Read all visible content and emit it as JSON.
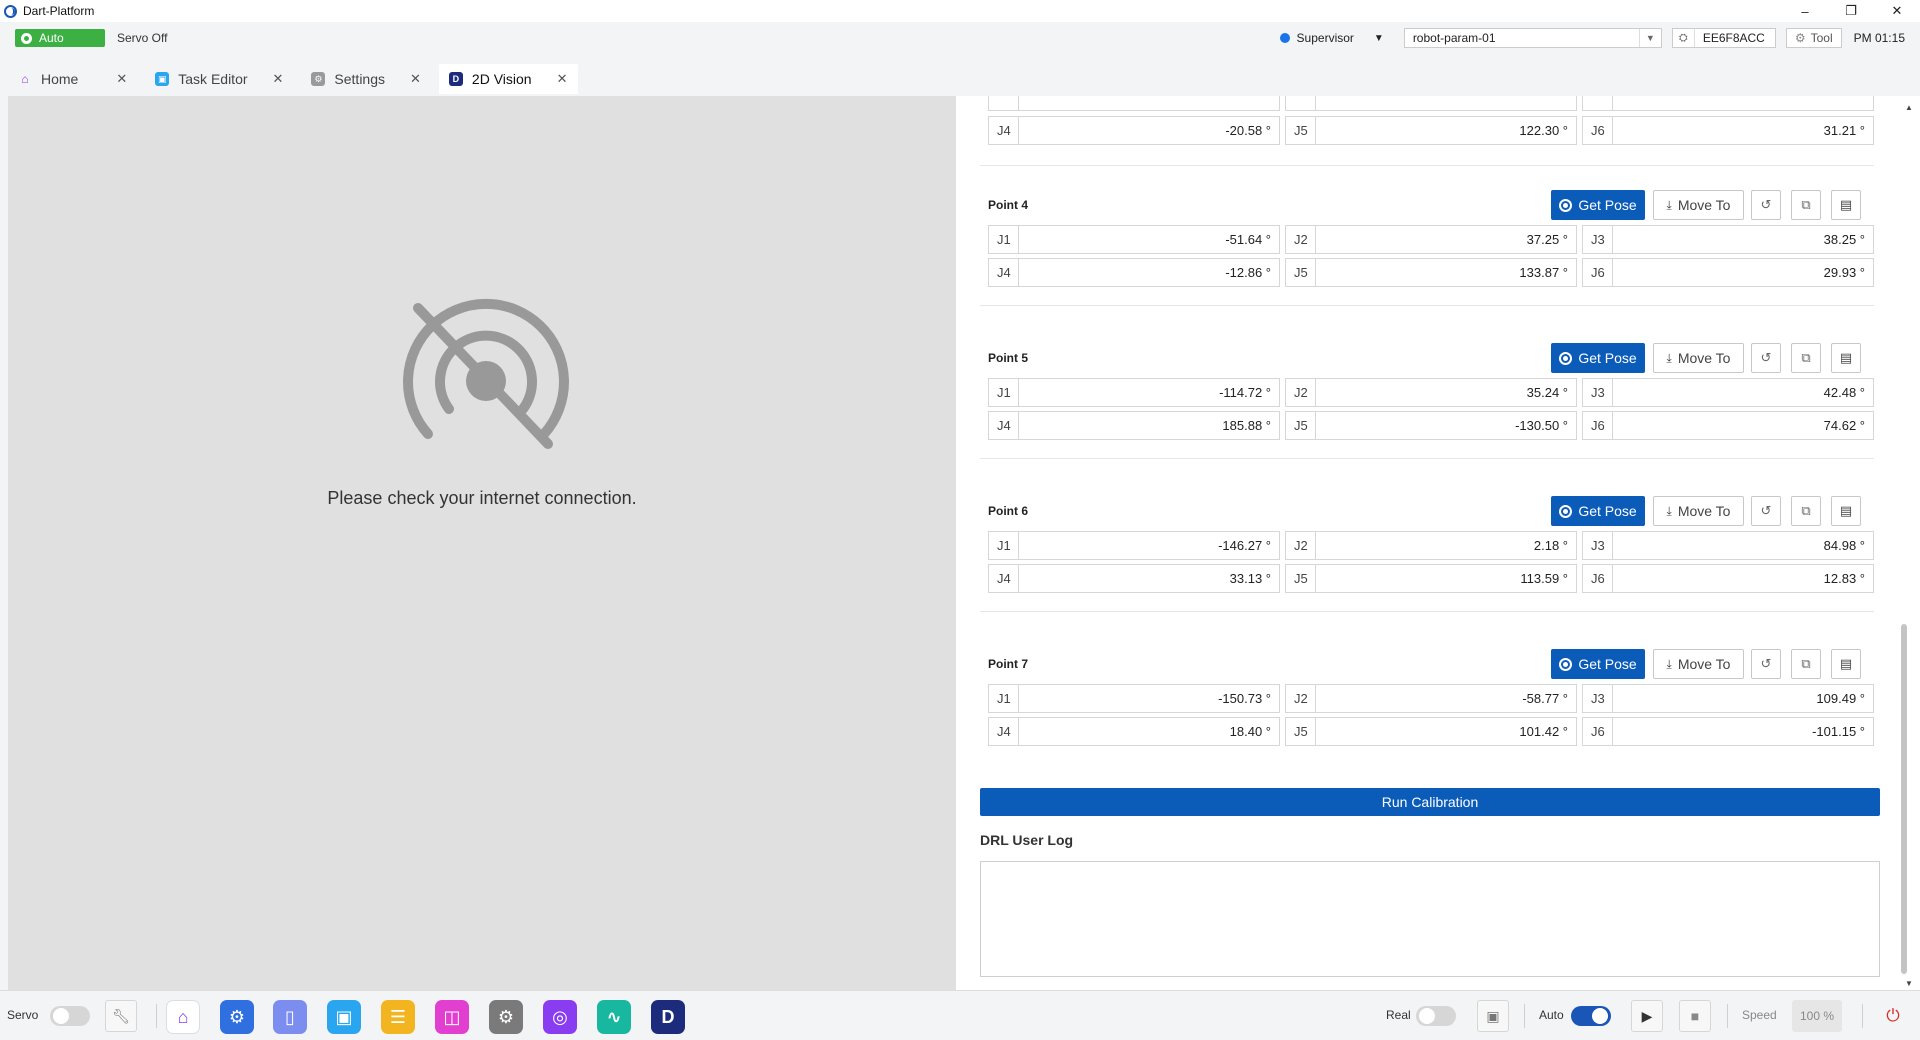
{
  "window": {
    "title": "Dart-Platform",
    "controls": [
      "–",
      "❐",
      "✕"
    ]
  },
  "status": {
    "mode_badge": "Auto",
    "servo_state": "Servo Off",
    "user_role": "Supervisor",
    "robot_param": "robot-param-01",
    "serial": "EE6F8ACC",
    "tool_label": "Tool",
    "clock": "PM 01:15"
  },
  "tabs": [
    {
      "label": "Home",
      "icon_color": "#fff",
      "active": false
    },
    {
      "label": "Task Editor",
      "icon_color": "#2aa6f0",
      "active": false
    },
    {
      "label": "Settings",
      "icon_color": "#9a9a9a",
      "active": false
    },
    {
      "label": "2D Vision",
      "icon_color": "#1d2b7d",
      "active": true
    }
  ],
  "left": {
    "message": "Please check your internet connection."
  },
  "partial_point": {
    "row2": [
      {
        "label": "J4",
        "value": "-20.58 °"
      },
      {
        "label": "J5",
        "value": "122.30 °"
      },
      {
        "label": "J6",
        "value": "31.21 °"
      }
    ]
  },
  "points": [
    {
      "title": "Point 4",
      "row1": [
        {
          "label": "J1",
          "value": "-51.64 °"
        },
        {
          "label": "J2",
          "value": "37.25 °"
        },
        {
          "label": "J3",
          "value": "38.25 °"
        }
      ],
      "row2": [
        {
          "label": "J4",
          "value": "-12.86 °"
        },
        {
          "label": "J5",
          "value": "133.87 °"
        },
        {
          "label": "J6",
          "value": "29.93 °"
        }
      ]
    },
    {
      "title": "Point 5",
      "row1": [
        {
          "label": "J1",
          "value": "-114.72 °"
        },
        {
          "label": "J2",
          "value": "35.24 °"
        },
        {
          "label": "J3",
          "value": "42.48 °"
        }
      ],
      "row2": [
        {
          "label": "J4",
          "value": "185.88 °"
        },
        {
          "label": "J5",
          "value": "-130.50 °"
        },
        {
          "label": "J6",
          "value": "74.62 °"
        }
      ]
    },
    {
      "title": "Point 6",
      "row1": [
        {
          "label": "J1",
          "value": "-146.27 °"
        },
        {
          "label": "J2",
          "value": "2.18 °"
        },
        {
          "label": "J3",
          "value": "84.98 °"
        }
      ],
      "row2": [
        {
          "label": "J4",
          "value": "33.13 °"
        },
        {
          "label": "J5",
          "value": "113.59 °"
        },
        {
          "label": "J6",
          "value": "12.83 °"
        }
      ]
    },
    {
      "title": "Point 7",
      "row1": [
        {
          "label": "J1",
          "value": "-150.73 °"
        },
        {
          "label": "J2",
          "value": "-58.77 °"
        },
        {
          "label": "J3",
          "value": "109.49 °"
        }
      ],
      "row2": [
        {
          "label": "J4",
          "value": "18.40 °"
        },
        {
          "label": "J5",
          "value": "101.42 °"
        },
        {
          "label": "J6",
          "value": "-101.15 °"
        }
      ]
    }
  ],
  "buttons": {
    "get_pose": "Get Pose",
    "move_to": "Move To",
    "run_calibration": "Run Calibration"
  },
  "log": {
    "title": "DRL User Log"
  },
  "dock": {
    "servo_label": "Servo",
    "real_label": "Real",
    "auto_label": "Auto",
    "speed_label": "Speed",
    "speed_value": "100 %",
    "apps": [
      {
        "name": "home-app-icon",
        "glyph": "⌂",
        "color": "#ffffff"
      },
      {
        "name": "robot-arm-app-icon",
        "glyph": "⚙",
        "color": "#2f6fe0"
      },
      {
        "name": "teach-pendant-app-icon",
        "glyph": "▯",
        "color": "#7b8ef0"
      },
      {
        "name": "task-editor-app-icon",
        "glyph": "▣",
        "color": "#2aa6f0"
      },
      {
        "name": "notes-app-icon",
        "glyph": "☰",
        "color": "#f2b51f"
      },
      {
        "name": "store-app-icon",
        "glyph": "◫",
        "color": "#e23fd0"
      },
      {
        "name": "settings-app-icon",
        "glyph": "⚙",
        "color": "#7a7a7a"
      },
      {
        "name": "target-app-icon",
        "glyph": "◎",
        "color": "#8a3df0"
      },
      {
        "name": "monitor-app-icon",
        "glyph": "∿",
        "color": "#18b8a0"
      },
      {
        "name": "dart-app-icon",
        "glyph": "D",
        "color": "#1d2b7d"
      }
    ]
  }
}
